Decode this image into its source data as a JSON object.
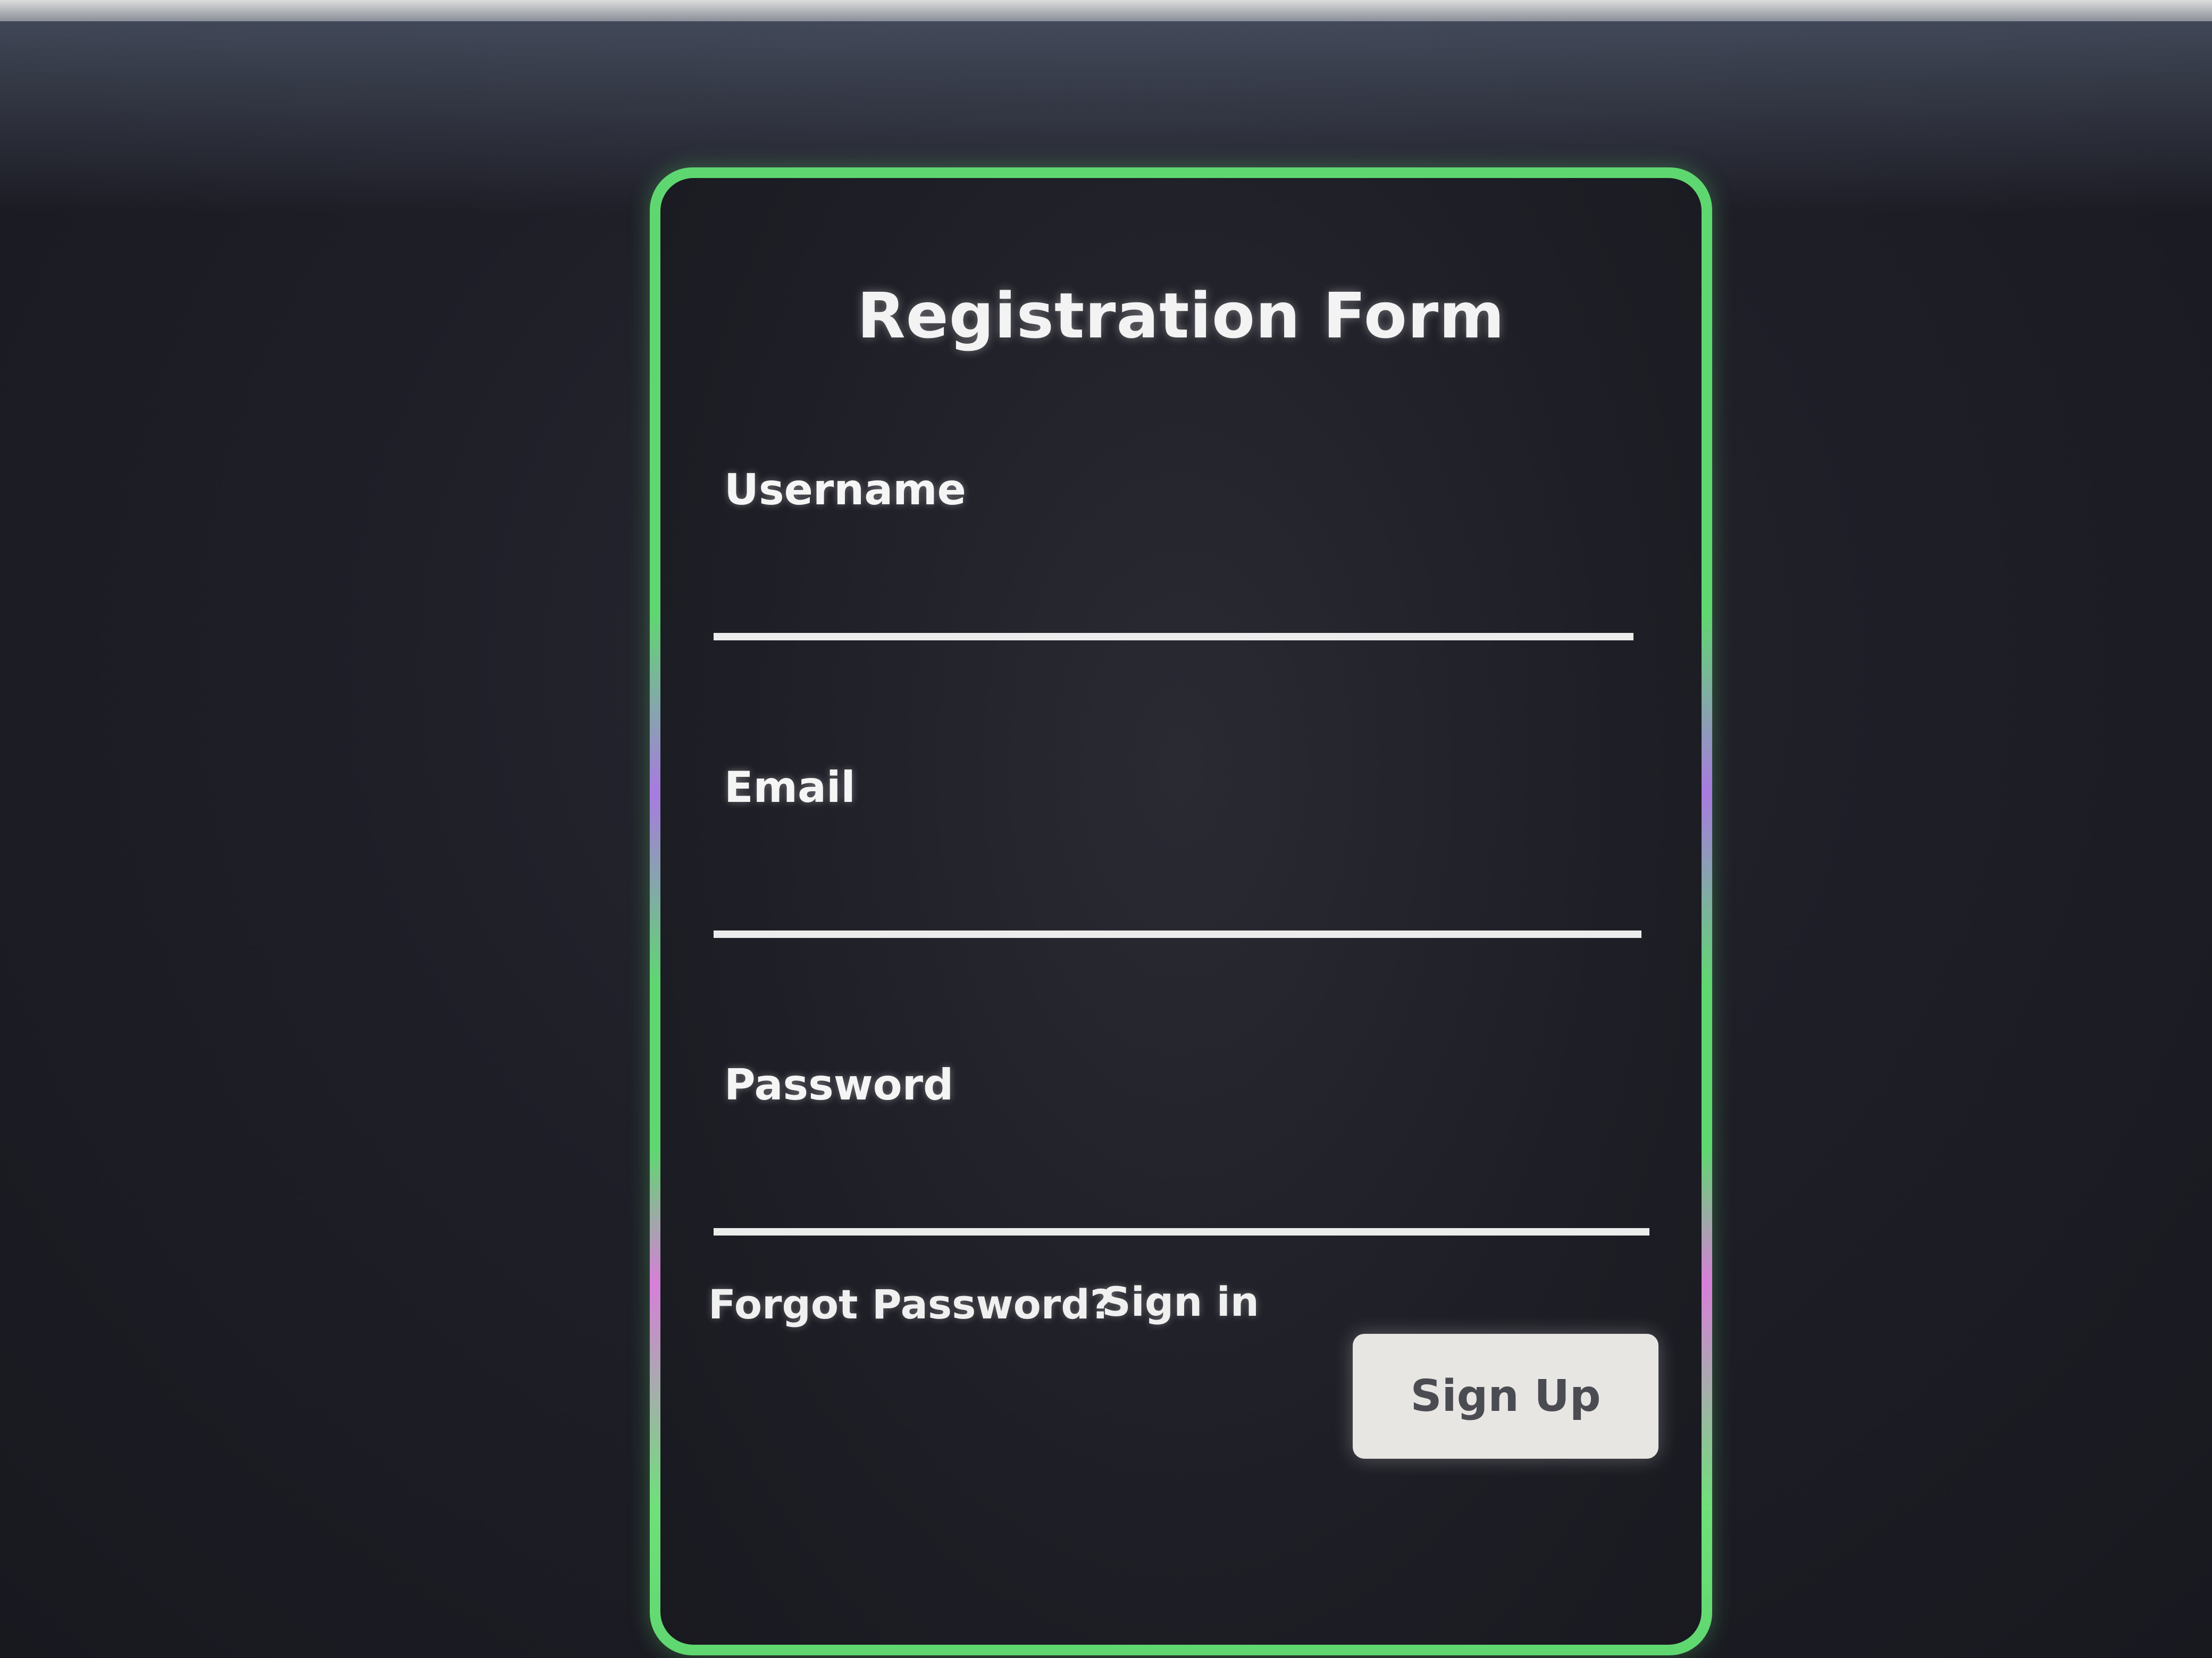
{
  "form": {
    "title": "Registration Form",
    "fields": [
      {
        "label": "Username",
        "value": "",
        "placeholder": ""
      },
      {
        "label": "Email",
        "value": "",
        "placeholder": ""
      },
      {
        "label": "Password",
        "value": "",
        "placeholder": ""
      }
    ],
    "forgot_password_label": "Forgot Password?",
    "sign_in_label": "Sign in",
    "sign_up_label": "Sign Up"
  },
  "colors": {
    "border_accent": "#5fd770",
    "border_secondary": "#d77fd9",
    "background": "#1e1e26",
    "text": "#f3f3f3",
    "button_background": "#e8e6e3",
    "button_text": "#4b4b52"
  }
}
